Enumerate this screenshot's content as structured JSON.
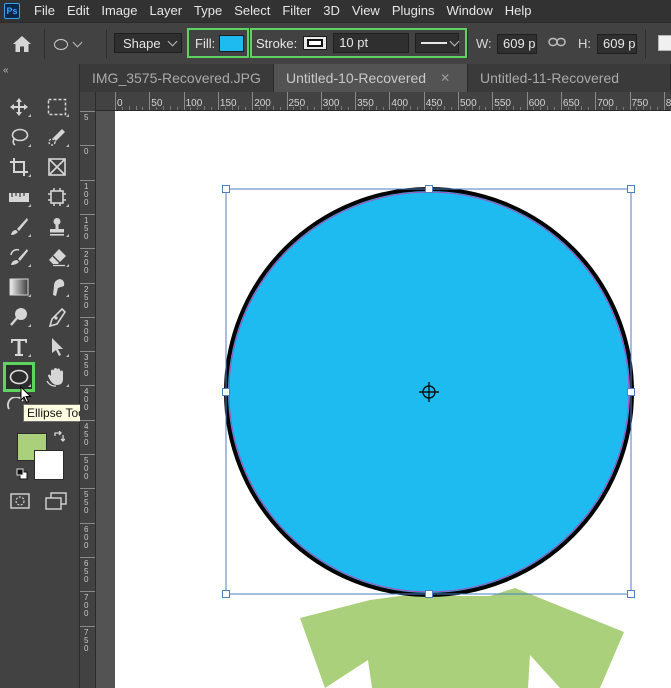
{
  "app": {
    "logo_text": "Ps"
  },
  "menu": [
    "File",
    "Edit",
    "Image",
    "Layer",
    "Type",
    "Select",
    "Filter",
    "3D",
    "View",
    "Plugins",
    "Window",
    "Help"
  ],
  "options": {
    "tool_mode": "Shape",
    "fill_label": "Fill:",
    "fill_color": "#1ebbf0",
    "stroke_label": "Stroke:",
    "stroke_width": "10 pt",
    "w_label": "W:",
    "w_value": "609 p",
    "h_label": "H:",
    "h_value": "609 p"
  },
  "tabs": [
    {
      "title": "IMG_3575-Recovered.JPG",
      "close": "✕"
    },
    {
      "title": "Untitled-10-Recovered",
      "close": "✕"
    },
    {
      "title": "Untitled-11-Recovered",
      "close": ""
    }
  ],
  "ruler": {
    "h_ticks": [
      "0",
      "50",
      "100",
      "150",
      "200",
      "250",
      "300",
      "350",
      "400",
      "450",
      "500",
      "550",
      "600",
      "650",
      "700",
      "750",
      "800"
    ],
    "v_ticks": [
      "5",
      "0",
      "1 0 0",
      "1 5 0",
      "2 0 0",
      "2 5 0",
      "3 0 0",
      "3 5 0",
      "4 0 0",
      "4 5 0",
      "5 0 0",
      "5 5 0",
      "6 0 0",
      "6 5 0",
      "7 0 0",
      "7 5 0"
    ]
  },
  "toolbar": {
    "collapse": "«",
    "tooltip": "Ellipse Tool (U)",
    "foreground_color": "#abd07b",
    "background_color": "#ffffff"
  },
  "canvas": {
    "circle_fill": "#1ebbf0",
    "circle_stroke": "#000000",
    "shirt_color": "#abd07b",
    "bounding_box_color": "#4a7fc0"
  }
}
